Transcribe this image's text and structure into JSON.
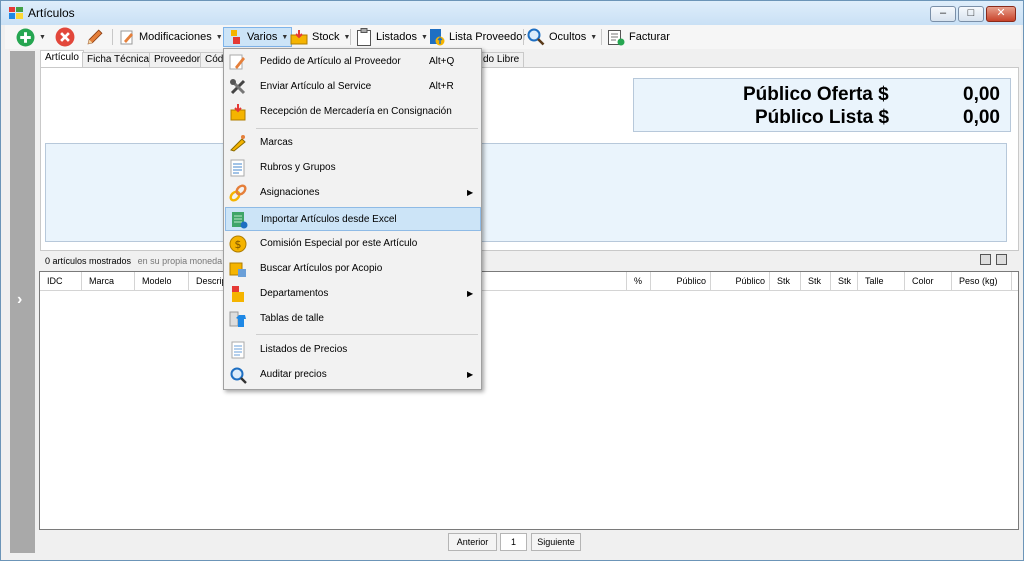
{
  "window": {
    "title": "Artículos",
    "controls": [
      "minimize",
      "maximize",
      "close"
    ]
  },
  "toolbar": {
    "modificaciones": "Modificaciones",
    "varios": "Varios",
    "stock": "Stock",
    "listados": "Listados",
    "lista_proveedor": "Lista Proveedor",
    "ocultos": "Ocultos",
    "facturar": "Facturar"
  },
  "tabs": [
    "Artículo",
    "Ficha Técnica",
    "Proveedor",
    "Códi",
    "do Libre"
  ],
  "prices": {
    "oferta_label": "Público Oferta $",
    "oferta_value": "0,00",
    "lista_label": "Público Lista $",
    "lista_value": "0,00"
  },
  "status": {
    "count": "0 artículos mostrados",
    "currency": "en su propia moneda"
  },
  "grid": {
    "columns": [
      "IDC",
      "Marca",
      "Modelo",
      "Descrip",
      "%",
      "Público",
      "Público",
      "Stk",
      "Stk",
      "Stk",
      "Talle",
      "Color",
      "Peso (kg)"
    ]
  },
  "pager": {
    "prev": "Anterior",
    "page": "1",
    "next": "Siguiente"
  },
  "menu": {
    "items": [
      {
        "label": "Pedido de Artículo al Proveedor",
        "shortcut": "Alt+Q",
        "icon": "pencil-icon"
      },
      {
        "label": "Enviar Artículo al Service",
        "shortcut": "Alt+R",
        "icon": "tools-icon"
      },
      {
        "label": "Recepción de Mercadería en Consignación",
        "icon": "box-icon"
      },
      {
        "label": "Marcas",
        "icon": "tag-icon"
      },
      {
        "label": "Rubros y Grupos",
        "icon": "list-icon"
      },
      {
        "label": "Asignaciones",
        "submenu": true,
        "icon": "link-icon"
      },
      {
        "label": "Importar Artículos desde Excel",
        "icon": "excel-icon",
        "highlighted": true
      },
      {
        "label": "Comisión Especial por este Artículo",
        "icon": "coin-icon"
      },
      {
        "label": "Buscar Artículos por Acopio",
        "icon": "search-box-icon"
      },
      {
        "label": "Departamentos",
        "submenu": true,
        "icon": "department-icon"
      },
      {
        "label": "Tablas de talle",
        "icon": "shirt-icon"
      },
      {
        "label": "Listados de Precios",
        "icon": "document-icon"
      },
      {
        "label": "Auditar precios",
        "submenu": true,
        "icon": "magnifier-icon"
      }
    ]
  }
}
